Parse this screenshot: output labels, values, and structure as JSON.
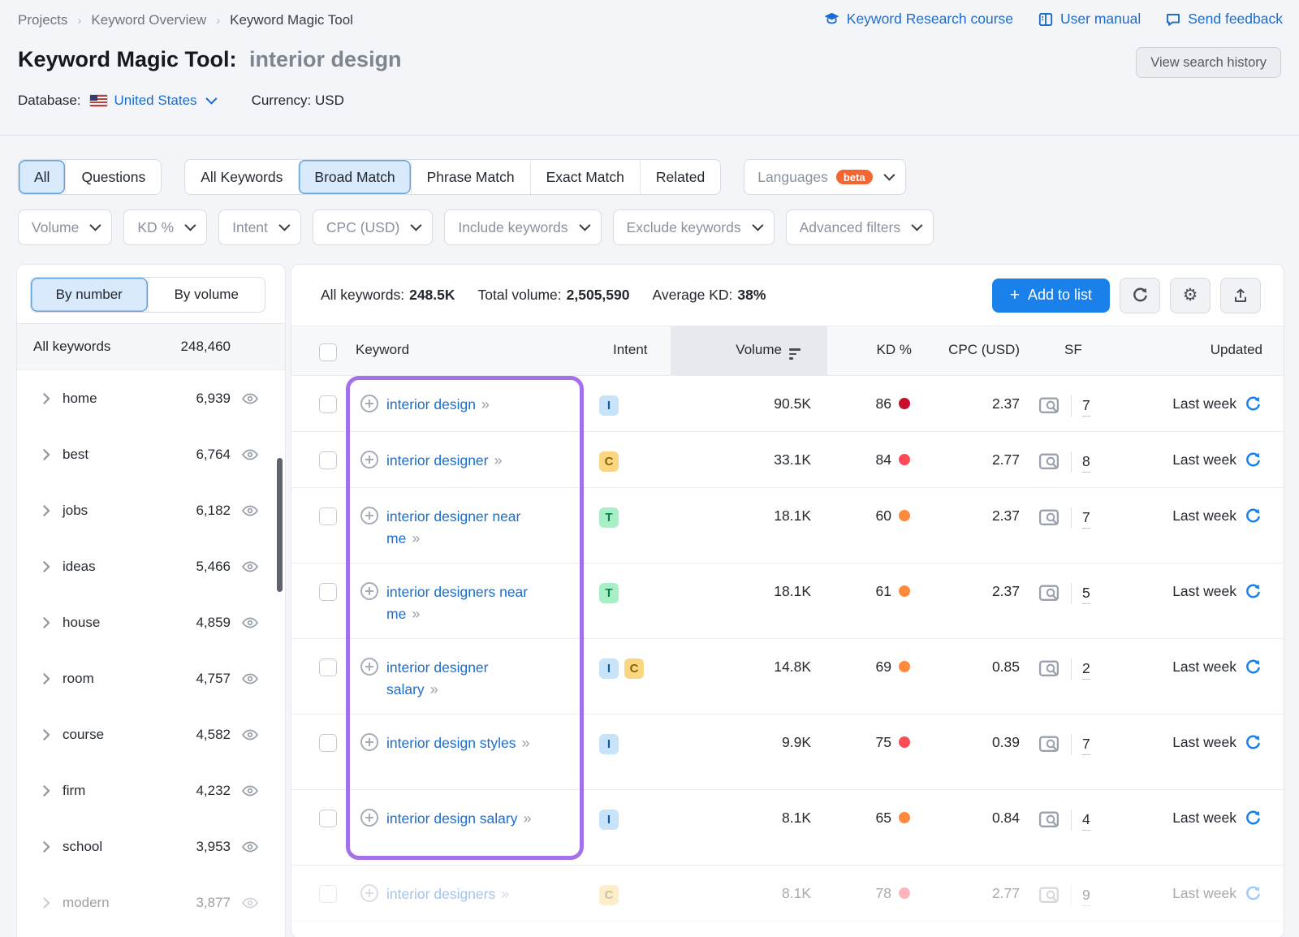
{
  "colors": {
    "accent": "#1a80ea",
    "link": "#1d6ccc",
    "purple": "#a471ea",
    "badge_orange": "#f4652f",
    "kd_very_hard": "#c8102e",
    "kd_hard": "#ff4b55",
    "kd_difficult": "#ff8a3d"
  },
  "breadcrumb": [
    "Projects",
    "Keyword Overview",
    "Keyword Magic Tool"
  ],
  "top_links": [
    {
      "label": "Keyword Research course",
      "icon": "graduation-cap-icon"
    },
    {
      "label": "User manual",
      "icon": "book-icon"
    },
    {
      "label": "Send feedback",
      "icon": "feedback-icon"
    }
  ],
  "page": {
    "title": "Keyword Magic Tool:",
    "query": "interior design",
    "history_button": "View search history"
  },
  "database_bar": {
    "label": "Database:",
    "value": "United States",
    "currency": "Currency: USD"
  },
  "match_tabs": {
    "group1": [
      {
        "label": "All",
        "active": true
      },
      {
        "label": "Questions",
        "active": false
      }
    ],
    "group2": [
      {
        "label": "All Keywords",
        "active": false
      },
      {
        "label": "Broad Match",
        "active": true
      },
      {
        "label": "Phrase Match",
        "active": false
      },
      {
        "label": "Exact Match",
        "active": false
      },
      {
        "label": "Related",
        "active": false
      }
    ],
    "languages": {
      "label": "Languages",
      "badge": "beta"
    }
  },
  "filter_dropdowns": [
    "Volume",
    "KD %",
    "Intent",
    "CPC (USD)",
    "Include keywords",
    "Exclude keywords",
    "Advanced filters"
  ],
  "summary": {
    "all_keywords_label": "All keywords:",
    "all_keywords": "248.5K",
    "total_volume_label": "Total volume:",
    "total_volume": "2,505,590",
    "avg_kd_label": "Average KD:",
    "avg_kd": "38%"
  },
  "toolbar": {
    "add_to_list": "Add to list",
    "icons": [
      "refresh-icon",
      "gear-icon",
      "export-icon"
    ]
  },
  "sidebar": {
    "toggle": [
      {
        "label": "By number",
        "active": true
      },
      {
        "label": "By volume",
        "active": false
      }
    ],
    "all_row": {
      "label": "All keywords",
      "count": "248,460"
    },
    "groups": [
      {
        "term": "home",
        "count": "6,939"
      },
      {
        "term": "best",
        "count": "6,764"
      },
      {
        "term": "jobs",
        "count": "6,182"
      },
      {
        "term": "ideas",
        "count": "5,466"
      },
      {
        "term": "house",
        "count": "4,859"
      },
      {
        "term": "room",
        "count": "4,757"
      },
      {
        "term": "course",
        "count": "4,582"
      },
      {
        "term": "firm",
        "count": "4,232"
      },
      {
        "term": "school",
        "count": "3,953"
      },
      {
        "term": "modern",
        "count": "3,877",
        "faded": true
      }
    ]
  },
  "table": {
    "columns": {
      "keyword": "Keyword",
      "intent": "Intent",
      "volume": "Volume",
      "kd": "KD %",
      "cpc": "CPC (USD)",
      "sf": "SF",
      "updated": "Updated"
    },
    "intent_styles": {
      "I": {
        "bg": "#c6e3fa",
        "fg": "#19599f"
      },
      "C": {
        "bg": "#fad680",
        "fg": "#8f5f0e"
      },
      "T": {
        "bg": "#a7efc5",
        "fg": "#0e7d54"
      }
    },
    "rows": [
      {
        "keyword": "interior design",
        "intents": [
          "I"
        ],
        "volume": "90.5K",
        "kd": "86",
        "kd_color": "#c8102e",
        "cpc": "2.37",
        "sf": "7",
        "updated": "Last week"
      },
      {
        "keyword": "interior designer",
        "intents": [
          "C"
        ],
        "volume": "33.1K",
        "kd": "84",
        "kd_color": "#ff4b55",
        "cpc": "2.77",
        "sf": "8",
        "updated": "Last week"
      },
      {
        "keyword": "interior designer near me",
        "intents": [
          "T"
        ],
        "volume": "18.1K",
        "kd": "60",
        "kd_color": "#ff8a3d",
        "cpc": "2.37",
        "sf": "7",
        "updated": "Last week"
      },
      {
        "keyword": "interior designers near me",
        "intents": [
          "T"
        ],
        "volume": "18.1K",
        "kd": "61",
        "kd_color": "#ff8a3d",
        "cpc": "2.37",
        "sf": "5",
        "updated": "Last week"
      },
      {
        "keyword": "interior designer salary",
        "intents": [
          "I",
          "C"
        ],
        "volume": "14.8K",
        "kd": "69",
        "kd_color": "#ff8a3d",
        "cpc": "0.85",
        "sf": "2",
        "updated": "Last week"
      },
      {
        "keyword": "interior design styles",
        "intents": [
          "I"
        ],
        "volume": "9.9K",
        "kd": "75",
        "kd_color": "#ff4b55",
        "cpc": "0.39",
        "sf": "7",
        "updated": "Last week"
      },
      {
        "keyword": "interior design salary",
        "intents": [
          "I"
        ],
        "volume": "8.1K",
        "kd": "65",
        "kd_color": "#ff8a3d",
        "cpc": "0.84",
        "sf": "4",
        "updated": "Last week"
      },
      {
        "keyword": "interior designers",
        "intents": [
          "C"
        ],
        "volume": "8.1K",
        "kd": "78",
        "kd_color": "#ff4b55",
        "cpc": "2.77",
        "sf": "9",
        "updated": "Last week",
        "faded": true
      }
    ]
  }
}
